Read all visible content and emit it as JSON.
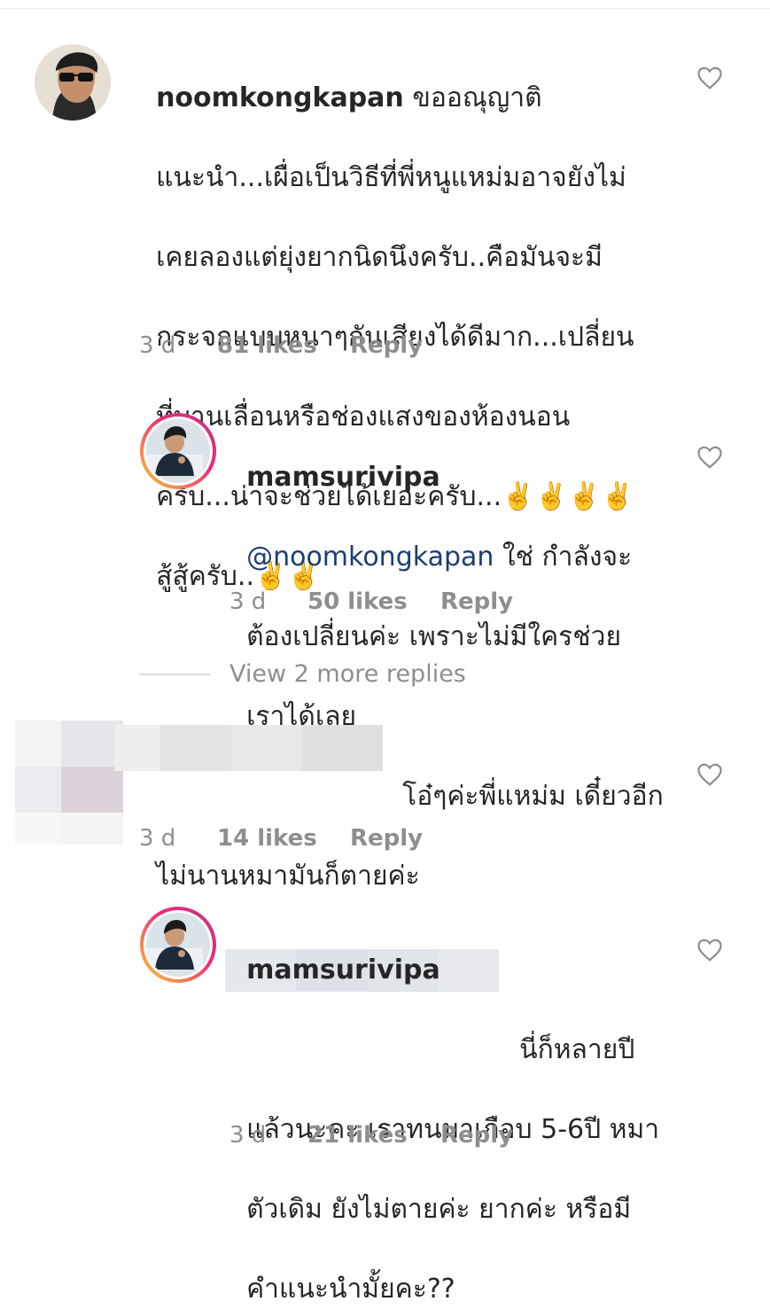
{
  "comments": [
    {
      "username": "noomkongkapan",
      "text": "ขออณุญาติ",
      "lines": [
        "แนะนำ...เผื่อเป็นวิธีที่พี่หนูแหม่มอาจยังไม่",
        "เคยลองแต่ยุ่งยากนิดนึงครับ..คือมันจะมี",
        "กระจกแบบหนาๆกันเสียงได้ดีมาก...เปลี่ยน",
        "ที่บานเลื่อนหรือช่องแสงของห้องนอน",
        "ครับ...น่าจะช่วยได้เยอะครับ...✌️✌️✌️✌️",
        "สู้สู้ครับ..✌️✌️"
      ],
      "time": "3 d",
      "likes": "81 likes",
      "reply": "Reply"
    },
    {
      "username": "mamsurivipa",
      "mention": "@noomkongkapan",
      "text": "ใช่ กำลังจะ",
      "lines": [
        "ต้องเปลี่ยนค่ะ เพราะไม่มีใครช่วย",
        "เราได้เลย"
      ],
      "time": "3 d",
      "likes": "50 likes",
      "reply": "Reply"
    },
    {
      "text": "โอ๋ๆค่ะพี่แหม่ม เดี๋ยวอีก",
      "lines": [
        "ไม่นานหมามันก็ตายค่ะ"
      ],
      "time": "3 d",
      "likes": "14 likes",
      "reply": "Reply"
    },
    {
      "username": "mamsurivipa",
      "text": "นี่ก็หลายปี",
      "lines": [
        "แล้วนะคะ เราทนมาเกือบ 5-6ปี หมา",
        "ตัวเดิม ยังไม่ตายค่ะ ยากค่ะ หรือมี",
        "คำแนะนำมั้ยคะ??"
      ],
      "time": "3 d",
      "likes": "21 likes",
      "reply": "Reply"
    }
  ],
  "view_more": "View 2 more replies",
  "icons": {
    "like": "heart-outline-icon"
  },
  "colors": {
    "text": "#262626",
    "muted": "#8e8e8e",
    "mention": "#1c3d73"
  }
}
